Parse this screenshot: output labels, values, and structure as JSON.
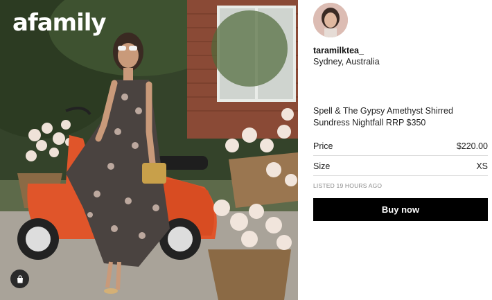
{
  "watermark": "afamily",
  "seller": {
    "username": "taramilktea_",
    "location": "Sydney, Australia"
  },
  "listing": {
    "title": "Spell & The Gypsy Amethyst Shirred Sundress Nightfall RRP $350",
    "price_label": "Price",
    "price_value": "$220.00",
    "size_label": "Size",
    "size_value": "XS",
    "listed": "LISTED 19 HOURS AGO",
    "buy_label": "Buy now"
  },
  "icons": {
    "bag": "shopping-bag-icon"
  },
  "colors": {
    "button_bg": "#000000",
    "scooter": "#e0552a"
  }
}
